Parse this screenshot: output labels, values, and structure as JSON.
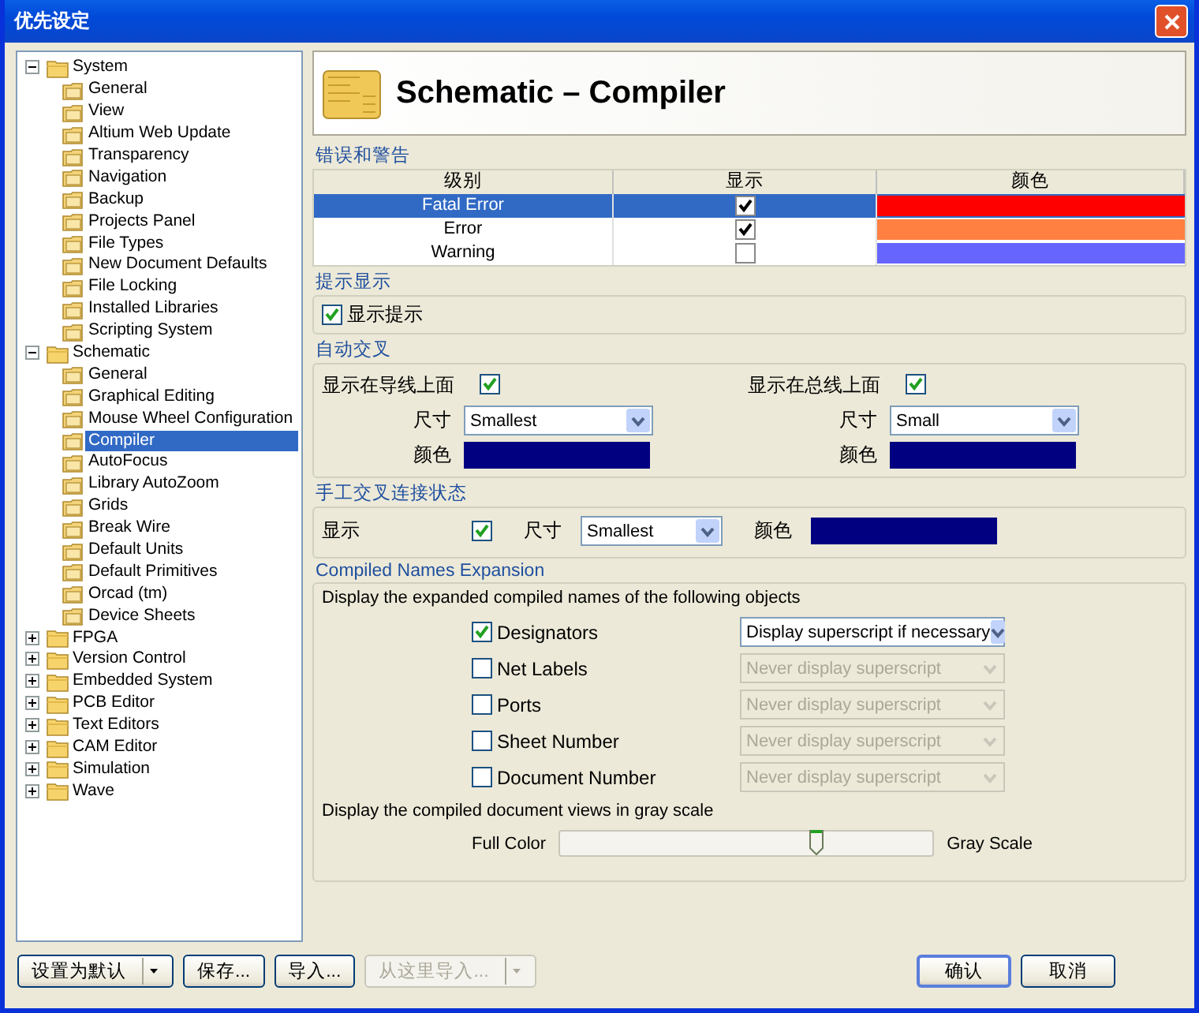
{
  "window": {
    "title": "优先设定"
  },
  "tree": [
    {
      "label": "System",
      "expanded": true,
      "selected": false,
      "children": [
        {
          "label": "General",
          "selected": false
        },
        {
          "label": "View",
          "selected": false
        },
        {
          "label": "Altium Web Update",
          "selected": false
        },
        {
          "label": "Transparency",
          "selected": false
        },
        {
          "label": "Navigation",
          "selected": false
        },
        {
          "label": "Backup",
          "selected": false
        },
        {
          "label": "Projects Panel",
          "selected": false
        },
        {
          "label": "File Types",
          "selected": false
        },
        {
          "label": "New Document Defaults",
          "selected": false
        },
        {
          "label": "File Locking",
          "selected": false
        },
        {
          "label": "Installed Libraries",
          "selected": false
        },
        {
          "label": "Scripting System",
          "selected": false
        }
      ]
    },
    {
      "label": "Schematic",
      "expanded": true,
      "selected": false,
      "children": [
        {
          "label": "General",
          "selected": false
        },
        {
          "label": "Graphical Editing",
          "selected": false
        },
        {
          "label": "Mouse Wheel Configuration",
          "selected": false
        },
        {
          "label": "Compiler",
          "selected": true
        },
        {
          "label": "AutoFocus",
          "selected": false
        },
        {
          "label": "Library AutoZoom",
          "selected": false
        },
        {
          "label": "Grids",
          "selected": false
        },
        {
          "label": "Break Wire",
          "selected": false
        },
        {
          "label": "Default Units",
          "selected": false
        },
        {
          "label": "Default Primitives",
          "selected": false
        },
        {
          "label": "Orcad (tm)",
          "selected": false
        },
        {
          "label": "Device Sheets",
          "selected": false
        }
      ]
    },
    {
      "label": "FPGA",
      "expanded": false,
      "selected": false
    },
    {
      "label": "Version Control",
      "expanded": false,
      "selected": false
    },
    {
      "label": "Embedded System",
      "expanded": false,
      "selected": false
    },
    {
      "label": "PCB Editor",
      "expanded": false,
      "selected": false
    },
    {
      "label": "Text Editors",
      "expanded": false,
      "selected": false
    },
    {
      "label": "CAM Editor",
      "expanded": false,
      "selected": false
    },
    {
      "label": "Simulation",
      "expanded": false,
      "selected": false
    },
    {
      "label": "Wave",
      "expanded": false,
      "selected": false
    }
  ],
  "page": {
    "title": "Schematic – Compiler"
  },
  "errors_group": {
    "title": "错误和警告",
    "columns": [
      "级别",
      "显示",
      "颜色"
    ],
    "rows": [
      {
        "level": "Fatal Error",
        "show": true,
        "color": "#ff0000",
        "selected": true
      },
      {
        "level": "Error",
        "show": true,
        "color": "#ff8040",
        "selected": false
      },
      {
        "level": "Warning",
        "show": false,
        "color": "#6666ff",
        "selected": false
      }
    ]
  },
  "hints_group": {
    "title": "提示显示",
    "label": "显示提示",
    "checked": true
  },
  "auto_junction": {
    "title": "自动交叉",
    "sides": [
      {
        "label": "显示在导线上面",
        "checked": true,
        "size_label": "尺寸",
        "size": "Smallest",
        "color_label": "颜色",
        "color": "#000080"
      },
      {
        "label": "显示在总线上面",
        "checked": true,
        "size_label": "尺寸",
        "size": "Small",
        "color_label": "颜色",
        "color": "#000080"
      }
    ]
  },
  "manual_junction": {
    "title": "手工交叉连接状态",
    "label": "显示",
    "checked": true,
    "size_label": "尺寸",
    "size": "Smallest",
    "color_label": "颜色",
    "color": "#000080"
  },
  "compiled_names": {
    "title": "Compiled Names Expansion",
    "intro": "Display the expanded compiled names of the following objects",
    "objects": [
      {
        "label": "Designators",
        "checked": true,
        "mode": "Display superscript if necessary"
      },
      {
        "label": "Net Labels",
        "checked": false,
        "mode": "Never display superscript"
      },
      {
        "label": "Ports",
        "checked": false,
        "mode": "Never display superscript"
      },
      {
        "label": "Sheet Number",
        "checked": false,
        "mode": "Never display superscript"
      },
      {
        "label": "Document Number",
        "checked": false,
        "mode": "Never display superscript"
      }
    ],
    "gray_label": "Display the compiled document views in gray scale",
    "slider": {
      "left": "Full Color",
      "right": "Gray Scale",
      "level": 0.69
    }
  },
  "buttons": [
    {
      "label": "设置为默认",
      "kind": "split",
      "disabled": false
    },
    {
      "label": "保存...",
      "kind": "plain",
      "disabled": false
    },
    {
      "label": "导入...",
      "kind": "plain",
      "disabled": false
    },
    {
      "label": "从这里导入...",
      "kind": "split",
      "disabled": true
    },
    {
      "label": "确认",
      "kind": "default",
      "disabled": false
    },
    {
      "label": "取消",
      "kind": "plain",
      "disabled": false
    }
  ]
}
